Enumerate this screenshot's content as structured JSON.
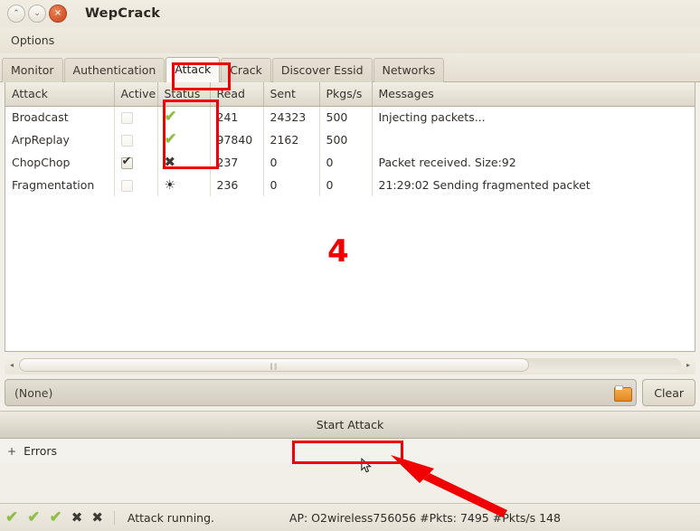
{
  "window": {
    "title": "WepCrack",
    "controls": [
      {
        "name": "minimize",
        "glyph": "⌃"
      },
      {
        "name": "maximize",
        "glyph": "⌄"
      },
      {
        "name": "close",
        "glyph": "×"
      }
    ]
  },
  "menubar": {
    "items": [
      "Options"
    ]
  },
  "tabs": [
    {
      "label": "Monitor",
      "active": false
    },
    {
      "label": "Authentication",
      "active": false
    },
    {
      "label": "Attack",
      "active": true
    },
    {
      "label": "Crack",
      "active": false
    },
    {
      "label": "Discover Essid",
      "active": false
    },
    {
      "label": "Networks",
      "active": false
    }
  ],
  "table": {
    "columns": [
      "Attack",
      "Active",
      "Status",
      "Read",
      "Sent",
      "Pkgs/s",
      "Messages"
    ],
    "rows": [
      {
        "attack": "Broadcast",
        "active": false,
        "status": "check",
        "status_glyph": "✔",
        "read": "241",
        "sent": "24323",
        "pkgs": "500",
        "message": "Injecting packets..."
      },
      {
        "attack": "ArpReplay",
        "active": false,
        "status": "check",
        "status_glyph": "✔",
        "read": "97840",
        "sent": "2162",
        "pkgs": "500",
        "message": ""
      },
      {
        "attack": "ChopChop",
        "active": true,
        "status": "cross",
        "status_glyph": "✖",
        "read": "237",
        "sent": "0",
        "pkgs": "0",
        "message": "Packet received. Size:92"
      },
      {
        "attack": "Fragmentation",
        "active": false,
        "status": "busy",
        "status_glyph": "☀",
        "read": "236",
        "sent": "0",
        "pkgs": "0",
        "message": "21:29:02  Sending fragmented packet"
      }
    ]
  },
  "annotations": {
    "step_number": "4",
    "accent_color": "#f00000"
  },
  "scrollbar": {
    "left_arrow": "◂",
    "right_arrow": "▸",
    "grip": "‖‖"
  },
  "file_row": {
    "value": "(None)",
    "browse_icon": "folder-icon",
    "clear_label": "Clear"
  },
  "attack_bar": {
    "button_label": "Start Attack"
  },
  "errors": {
    "expander": "+",
    "label": "Errors"
  },
  "statusbar": {
    "icons": [
      "✔",
      "✔",
      "✔",
      "✖",
      "✖"
    ],
    "status_text": "Attack running.",
    "info_text": "AP: O2wireless756056  #Pkts: 7495 #Pkts/s 148",
    "ap": "O2wireless756056",
    "pkts": "7495",
    "pkts_per_s": "148"
  }
}
